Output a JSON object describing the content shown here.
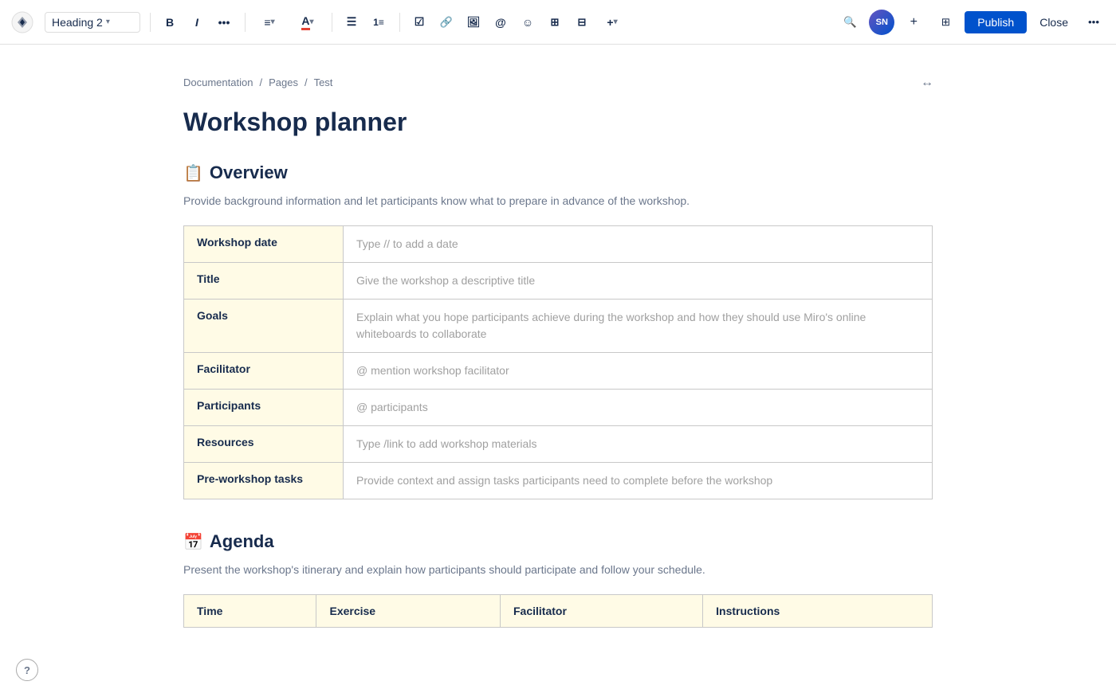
{
  "toolbar": {
    "heading_dropdown_label": "Heading 2",
    "bold_label": "B",
    "italic_label": "I",
    "more_label": "•••",
    "align_label": "≡",
    "color_label": "A",
    "bullet_label": "≡",
    "numbered_label": "≡",
    "task_label": "☑",
    "link_label": "🔗",
    "image_label": "🖼",
    "mention_label": "@",
    "emoji_label": "☺",
    "table_label": "⊞",
    "columns_label": "⊟",
    "more2_label": "+▾",
    "avatar_initials": "SN",
    "add_label": "+",
    "template_label": "⊞",
    "publish_label": "Publish",
    "close_label": "Close",
    "extra_label": "•••"
  },
  "breadcrumb": {
    "items": [
      "Documentation",
      "Pages",
      "Test"
    ],
    "separator": "/"
  },
  "page": {
    "title": "Workshop planner"
  },
  "overview_section": {
    "icon": "📋",
    "heading": "Overview",
    "description": "Provide background information and let participants know what to prepare in advance of the workshop.",
    "table_rows": [
      {
        "label": "Workshop date",
        "placeholder": "Type // to add a date"
      },
      {
        "label": "Title",
        "placeholder": "Give the workshop a descriptive title"
      },
      {
        "label": "Goals",
        "placeholder": "Explain what you hope participants achieve during the workshop and how they should use Miro's online whiteboards to collaborate"
      },
      {
        "label": "Facilitator",
        "placeholder": "@ mention workshop facilitator"
      },
      {
        "label": "Participants",
        "placeholder": "@ participants"
      },
      {
        "label": "Resources",
        "placeholder": "Type /link to add workshop materials"
      },
      {
        "label": "Pre-workshop tasks",
        "placeholder": "Provide context and assign tasks participants need to complete before the workshop"
      }
    ]
  },
  "agenda_section": {
    "icon": "📅",
    "heading": "Agenda",
    "description": "Present the workshop's itinerary and explain how participants should participate and follow your schedule.",
    "table_headers": [
      "Time",
      "Exercise",
      "Facilitator",
      "Instructions"
    ]
  }
}
